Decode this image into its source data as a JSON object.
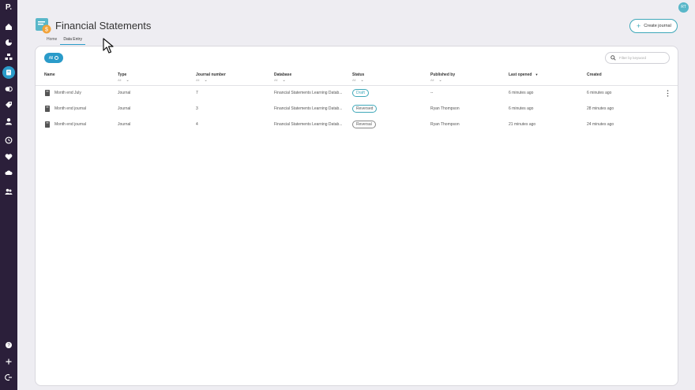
{
  "app": {
    "logo_letter": "P.",
    "avatar_initials": "RT"
  },
  "header": {
    "title": "Financial Statements",
    "create_label": "Create journal"
  },
  "tabs": [
    {
      "label": "Home"
    },
    {
      "label": "Data Entry"
    }
  ],
  "filters": {
    "all_label": "All",
    "search_placeholder": "Filter by keyword"
  },
  "columns": [
    {
      "label": "Name",
      "sub": ""
    },
    {
      "label": "Type",
      "sub": "All"
    },
    {
      "label": "Journal number",
      "sub": "All"
    },
    {
      "label": "Database",
      "sub": "All"
    },
    {
      "label": "Status",
      "sub": "All"
    },
    {
      "label": "Published by",
      "sub": "All"
    },
    {
      "label": "Last opened",
      "sub": ""
    },
    {
      "label": "Created",
      "sub": ""
    }
  ],
  "rows": [
    {
      "name": "Month end July",
      "type": "Journal",
      "number": "7",
      "database": "Financial Statements Learning Datab...",
      "status": "Draft",
      "published_by": "--",
      "last_opened": "6 minutes ago",
      "created": "6 minutes ago"
    },
    {
      "name": "Month end journal",
      "type": "Journal",
      "number": "3",
      "database": "Financial Statements Learning Datab...",
      "status": "Reversed",
      "published_by": "Ryan Thompson",
      "last_opened": "6 minutes ago",
      "created": "28 minutes ago"
    },
    {
      "name": "Month end journal",
      "type": "Journal",
      "number": "4",
      "database": "Financial Statements Learning Datab...",
      "status": "Reversal",
      "published_by": "Ryan Thompson",
      "last_opened": "21 minutes ago",
      "created": "24 minutes ago"
    }
  ],
  "colors": {
    "accent": "#2a9bc9",
    "sidebar": "#2b1f3a"
  }
}
